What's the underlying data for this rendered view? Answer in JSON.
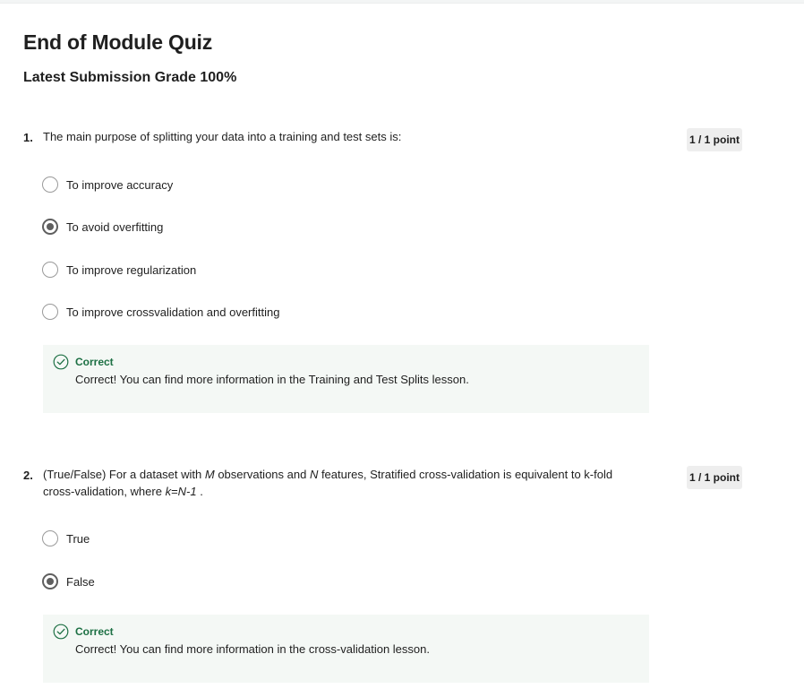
{
  "quiz": {
    "title": "End of Module Quiz",
    "grade_text": "Latest Submission Grade 100%"
  },
  "questions": [
    {
      "number": "1.",
      "text": "The main purpose of splitting your data into a training and test sets is:",
      "points": "1 / 1 point",
      "options": [
        {
          "label": "To improve accuracy",
          "selected": false
        },
        {
          "label": "To avoid overfitting",
          "selected": true
        },
        {
          "label": "To improve regularization",
          "selected": false
        },
        {
          "label": "To improve crossvalidation and overfitting",
          "selected": false
        }
      ],
      "feedback": {
        "title": "Correct",
        "text": "Correct! You can find more information in the Training and Test Splits lesson."
      }
    },
    {
      "number": "2.",
      "text_parts": {
        "p1": "(True/False) For a dataset with ",
        "m": "M",
        "p2": " observations and ",
        "n": "N",
        "p3": " features, Stratified cross-validation is equivalent to k-fold cross-validation, where ",
        "k": "k",
        "eq": "=",
        "nm1": "N-1",
        "p4": " ."
      },
      "points": "1 / 1 point",
      "options": [
        {
          "label": "True",
          "selected": false
        },
        {
          "label": "False",
          "selected": true
        }
      ],
      "feedback": {
        "title": "Correct",
        "text": "Correct! You can find more information in the cross-validation lesson."
      }
    }
  ],
  "colors": {
    "correct_green": "#1d7044",
    "feedback_bg": "#f4f8f5",
    "radio_selected": "#5f5f5f"
  },
  "icons": {
    "feedback": "check-circle-icon"
  }
}
